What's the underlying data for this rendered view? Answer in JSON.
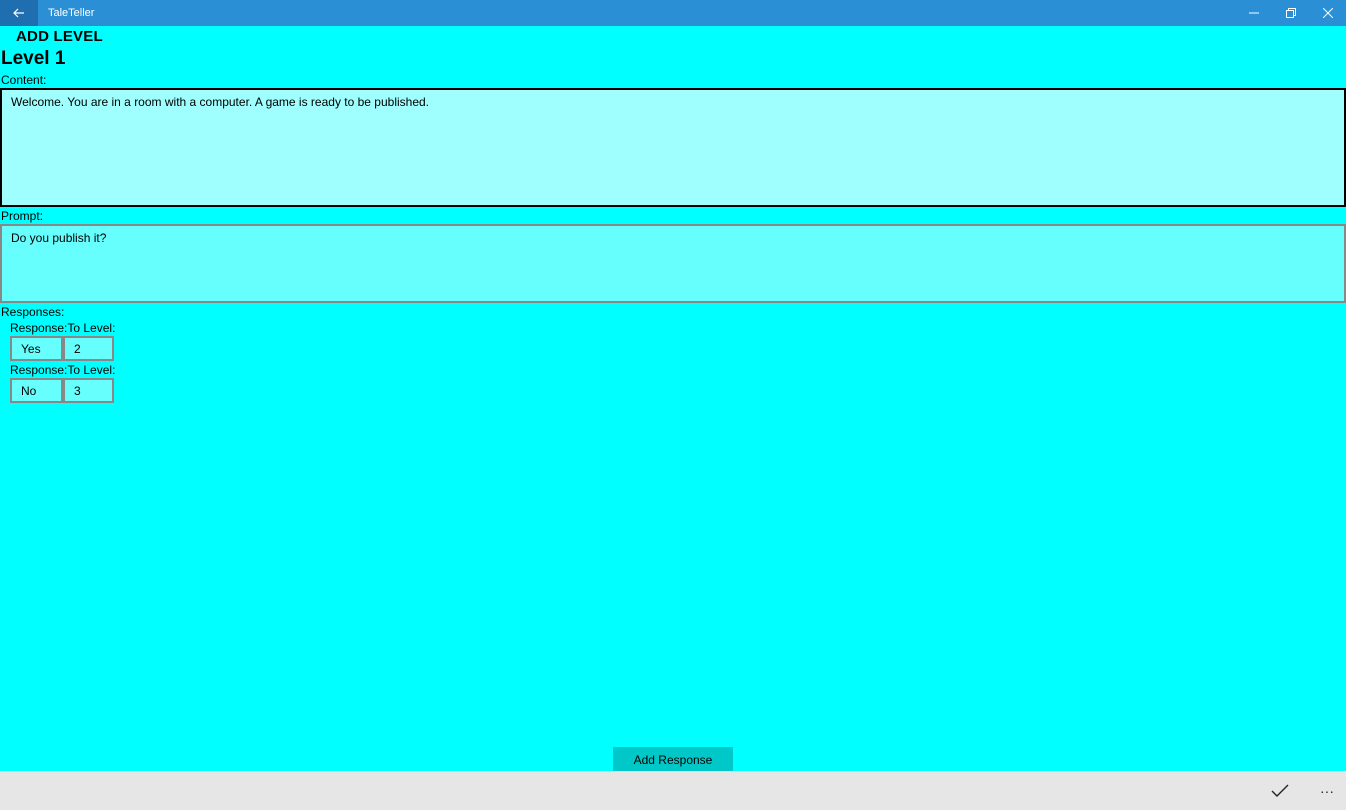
{
  "window": {
    "title": "TaleTeller",
    "accent_color": "#2b8fd6",
    "back_icon": "arrow-left-icon",
    "controls": [
      "minimize-icon",
      "restore-icon",
      "close-icon"
    ]
  },
  "page": {
    "header": "ADD LEVEL",
    "level_title": "Level 1",
    "background_color": "#00ffff"
  },
  "content": {
    "label": "Content:",
    "value": "Welcome. You are in a room with a computer. A game is ready to be published."
  },
  "prompt": {
    "label": "Prompt:",
    "value": "Do you publish it?"
  },
  "responses": {
    "label": "Responses:",
    "response_label": "Response:",
    "to_level_label": "To Level:",
    "items": [
      {
        "response": "Yes",
        "to_level": "2"
      },
      {
        "response": "No",
        "to_level": "3"
      }
    ]
  },
  "actions": {
    "add_response": "Add Response",
    "accept_icon": "checkmark-icon",
    "more_icon": "more-icon",
    "more_glyph": "···"
  }
}
